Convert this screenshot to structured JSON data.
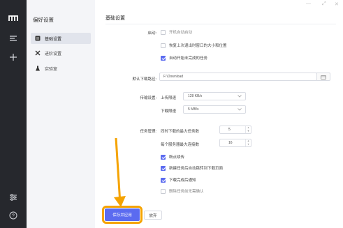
{
  "rail": {
    "icons": [
      "logo-icon",
      "menu-icon",
      "plus-icon",
      "sliders-icon",
      "help-icon"
    ]
  },
  "sidebar": {
    "title": "偏好设置",
    "items": [
      {
        "label": "基础设置",
        "icon": "grid-icon",
        "active": true
      },
      {
        "label": "进阶设置",
        "icon": "tools-icon",
        "active": false
      },
      {
        "label": "实验室",
        "icon": "flask-icon",
        "active": false
      }
    ]
  },
  "main": {
    "section_title": "基础设置",
    "startup": {
      "label": "启动:",
      "options": [
        {
          "text": "开机自动启动",
          "checked": false
        },
        {
          "text": "恢复上次退出时窗口的大小和位置",
          "checked": false
        },
        {
          "text": "自动开始未完成的任务",
          "checked": true
        }
      ]
    },
    "download_path": {
      "label": "默认下载路径:",
      "value": "F:\\Download"
    },
    "transfer": {
      "label": "传输设置:",
      "upload_label": "上传限速",
      "upload_value": "128 KB/s",
      "download_label": "下载限速",
      "download_value": "5 MB/s"
    },
    "tasks": {
      "label": "任务管理:",
      "max_tasks_label": "同时下载的最大任务数",
      "max_tasks_value": "5",
      "max_conn_label": "每个服务器最大连接数",
      "max_conn_value": "16",
      "options": [
        {
          "text": "断点续传",
          "checked": true
        },
        {
          "text": "新建任务后自动跳转到下载页面",
          "checked": true
        },
        {
          "text": "下载完成后通知",
          "checked": true
        },
        {
          "text": "删除任务前无需确认",
          "checked": false
        }
      ]
    },
    "buttons": {
      "save": "保存并应用",
      "discard": "放弃"
    }
  },
  "colors": {
    "accent": "#5b6bf0",
    "highlight": "#f5a300",
    "rail_bg": "#26282d",
    "sidebar_bg": "#f4f5f8"
  }
}
